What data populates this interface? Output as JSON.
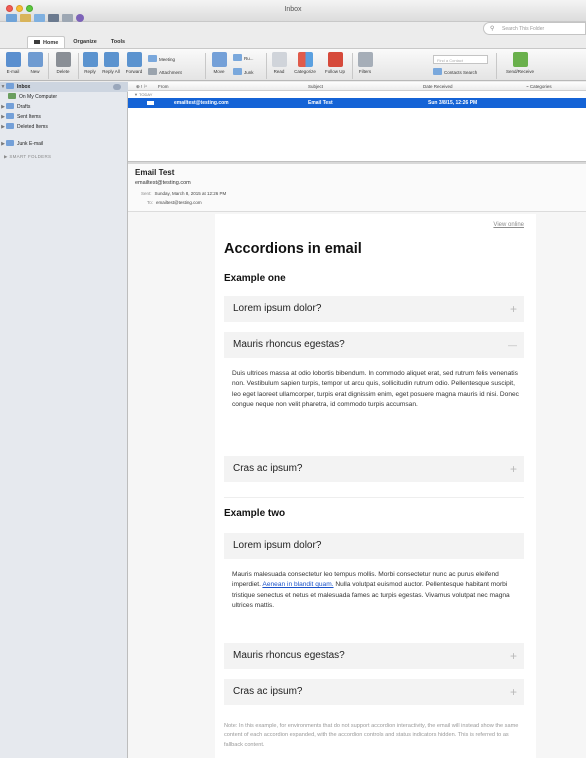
{
  "window": {
    "title": "Inbox"
  },
  "search": {
    "placeholder": "Search This Folder"
  },
  "tabs": [
    {
      "label": "Home",
      "active": true
    },
    {
      "label": "Organize",
      "active": false
    },
    {
      "label": "Tools",
      "active": false
    }
  ],
  "ribbon": {
    "email": "E-mail",
    "new": "New",
    "delete": "Delete",
    "reply": "Reply",
    "reply_all": "Reply All",
    "forward": "Forward",
    "meeting": "Meeting",
    "attachment": "Attachment",
    "move": "Move",
    "rules": "Ru...",
    "junk": "Junk",
    "read": "Read",
    "categorize": "Categorize",
    "follow_up": "Follow Up",
    "filters": "Filters",
    "find_contact_placeholder": "Find a Contact",
    "contacts_search": "Contacts Search",
    "send_receive": "Send/Receive"
  },
  "sidebar": {
    "inbox": "Inbox",
    "on_my_computer": "On My Computer",
    "drafts": "Drafts",
    "sent": "Sent Items",
    "deleted": "Deleted Items",
    "junk": "Junk E-mail",
    "smart_folders": "SMART FOLDERS"
  },
  "list": {
    "col_from": "From",
    "col_subject": "Subject",
    "col_date": "Date Received",
    "col_categories": "Categories",
    "group_today": "TODAY",
    "rows": [
      {
        "from": "emailtest@testing.com",
        "subject": "Email Test",
        "date": "Sun 3/8/15, 12:26 PM"
      }
    ]
  },
  "message": {
    "subject": "Email Test",
    "from": "emailtest@testing.com",
    "sent_label": "Sent:",
    "sent_value": "Sunday, March 8, 2015 at 12:26 PM",
    "to_label": "To:",
    "to_value": "emailtest@testing.com"
  },
  "email": {
    "view_online": "View online",
    "title": "Accordions in email",
    "example_one": "Example one",
    "e1_item1": "Lorem ipsum dolor?",
    "e1_item2": "Mauris rhoncus egestas?",
    "e1_item2_body": "Duis ultrices massa at odio lobortis bibendum. In commodo aliquet erat, sed rutrum felis venenatis non. Vestibulum sapien turpis, tempor ut arcu quis, sollicitudin rutrum odio. Pellentesque suscipit, leo eget laoreet ullamcorper, turpis erat dignissim enim, eget posuere magna mauris id nisi. Donec congue neque non velit pharetra, id commodo turpis accumsan.",
    "e1_item3": "Cras ac ipsum?",
    "example_two": "Example two",
    "e2_item1": "Lorem ipsum dolor?",
    "e2_item1_body_a": "Mauris malesuada consectetur leo tempus mollis. Morbi consectetur nunc ac purus eleifend imperdiet. ",
    "e2_item1_link": "Aenean in blandit quam.",
    "e2_item1_body_b": " Nulla volutpat euismod auctor. Pellentesque habitant morbi tristique senectus et netus et malesuada fames ac turpis egestas. Vivamus volutpat nec magna ultrices mattis.",
    "e2_item2": "Mauris rhoncus egestas?",
    "e2_item3": "Cras ac ipsum?",
    "plus_glyph": "+",
    "minus_glyph": "—",
    "note": "Note: In this example, for environments that do not support accordion interactivity, the email will instead show the same content of each accordion expanded, with the accordion controls and status indicators hidden. This is referred to as fallback content."
  },
  "colors": {
    "selection": "#1463d6",
    "link": "#1a52c9"
  }
}
